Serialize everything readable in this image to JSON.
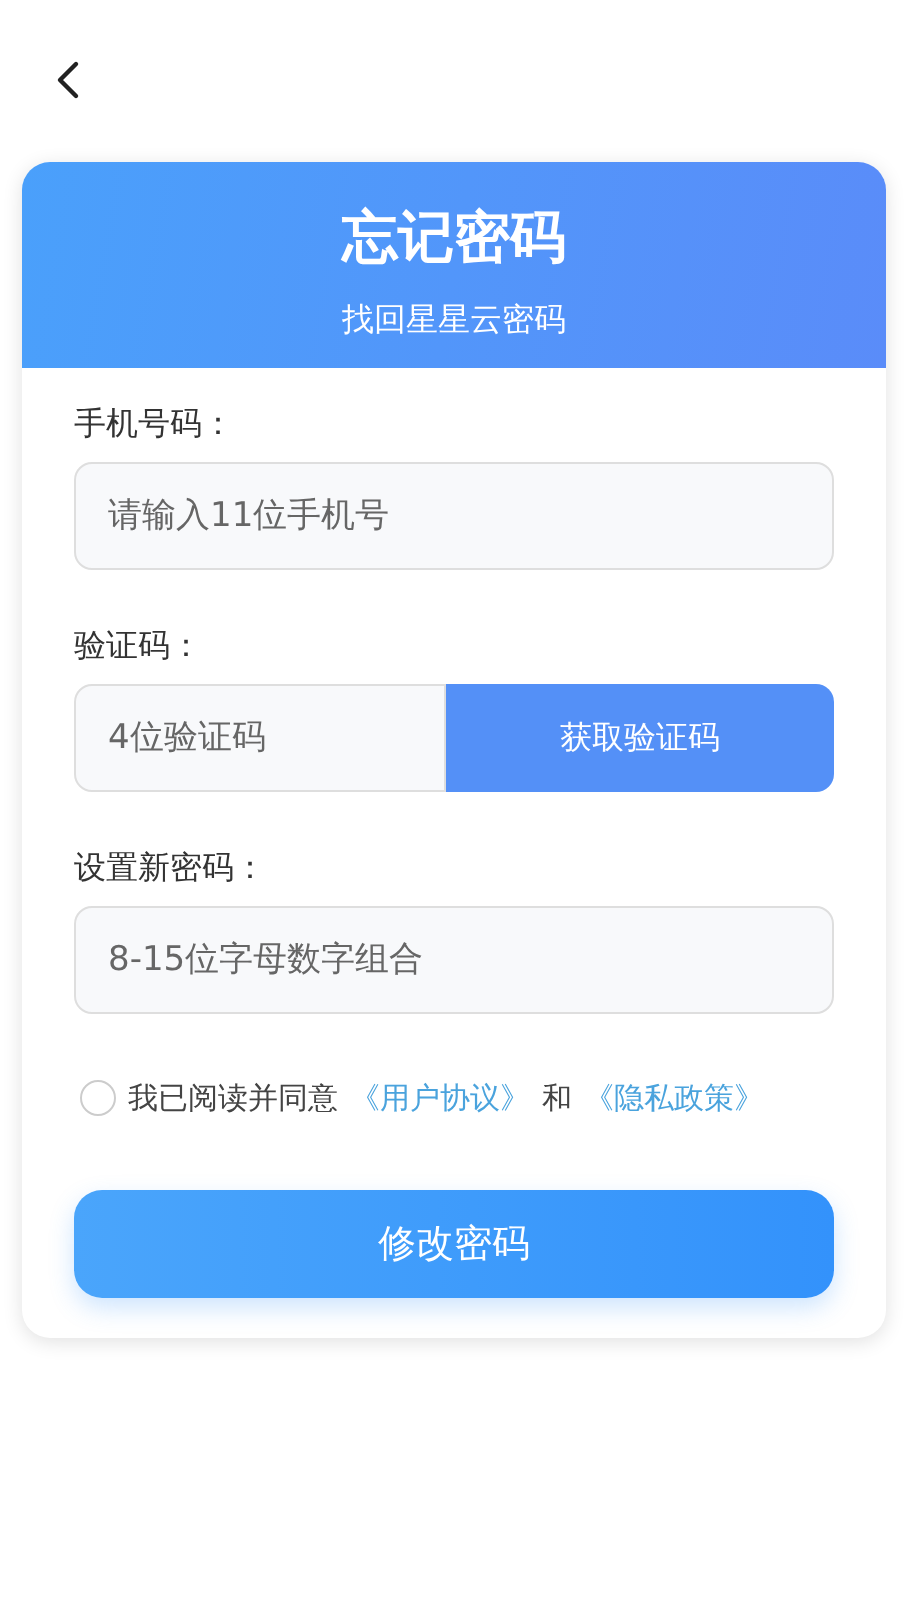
{
  "header": {
    "title": "忘记密码",
    "subtitle": "找回星星云密码"
  },
  "fields": [
    {
      "kind": "input",
      "label": "手机号码：",
      "placeholder": "请输入11位手机号"
    },
    {
      "kind": "code",
      "label": "验证码：",
      "placeholder": "4位验证码",
      "button": "获取验证码"
    },
    {
      "kind": "input",
      "label": "设置新密码：",
      "placeholder": "8-15位字母数字组合"
    }
  ],
  "agreement": {
    "checked": false,
    "text": "我已阅读并同意",
    "link_1": "《用户协议》",
    "joiner": "和",
    "link_2": "《隐私政策》"
  },
  "submit": "修改密码"
}
